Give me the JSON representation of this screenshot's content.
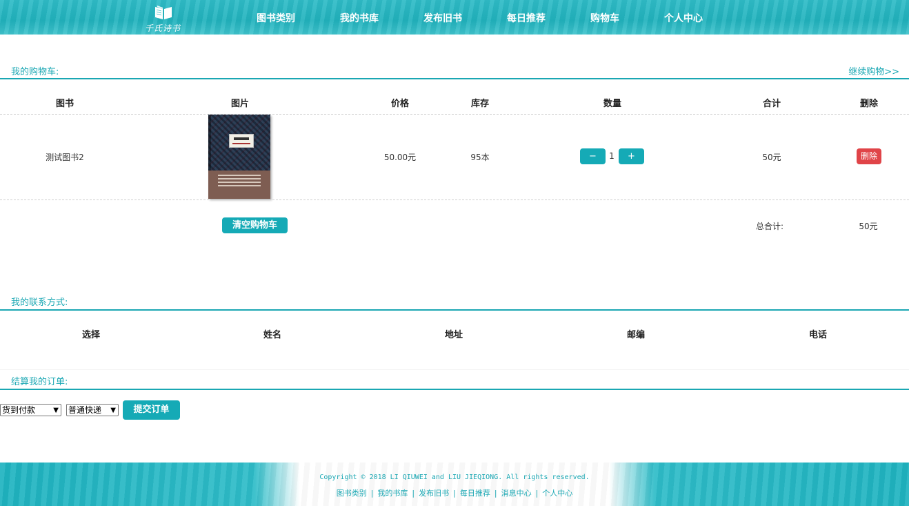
{
  "header": {
    "logo_text": "千氏诗书",
    "nav": [
      "图书类别",
      "我的书库",
      "发布旧书",
      "每日推荐",
      "购物车",
      "个人中心"
    ]
  },
  "cart": {
    "title": "我的购物车:",
    "continue_label": "继续购物>>",
    "columns": [
      "图书",
      "图片",
      "价格",
      "库存",
      "数量",
      "合计",
      "删除"
    ],
    "items": [
      {
        "name": "测试图书2",
        "cover_title": "老子之道",
        "price": "50.00元",
        "stock": "95本",
        "quantity": "1",
        "subtotal": "50元",
        "delete_label": "删除"
      }
    ],
    "minus_label": "−",
    "plus_label": "+",
    "clear_label": "清空购物车",
    "total_label": "总合计:",
    "total_value": "50元"
  },
  "contact": {
    "title": "我的联系方式:",
    "columns": [
      "选择",
      "姓名",
      "地址",
      "邮编",
      "电话"
    ]
  },
  "checkout": {
    "title": "结算我的订单:",
    "payment_selected": "货到付款",
    "shipping_selected": "普通快递",
    "submit_label": "提交订单"
  },
  "footer": {
    "copyright": "Copyright © 2018 LI QIUWEI and LIU JIEQIONG. All rights reserved.",
    "links": [
      "图书类别",
      "我的书库",
      "发布旧书",
      "每日推荐",
      "消息中心",
      "个人中心"
    ]
  },
  "colors": {
    "accent": "#1aa7b3",
    "button": "#15aab6",
    "danger": "#e04448"
  }
}
